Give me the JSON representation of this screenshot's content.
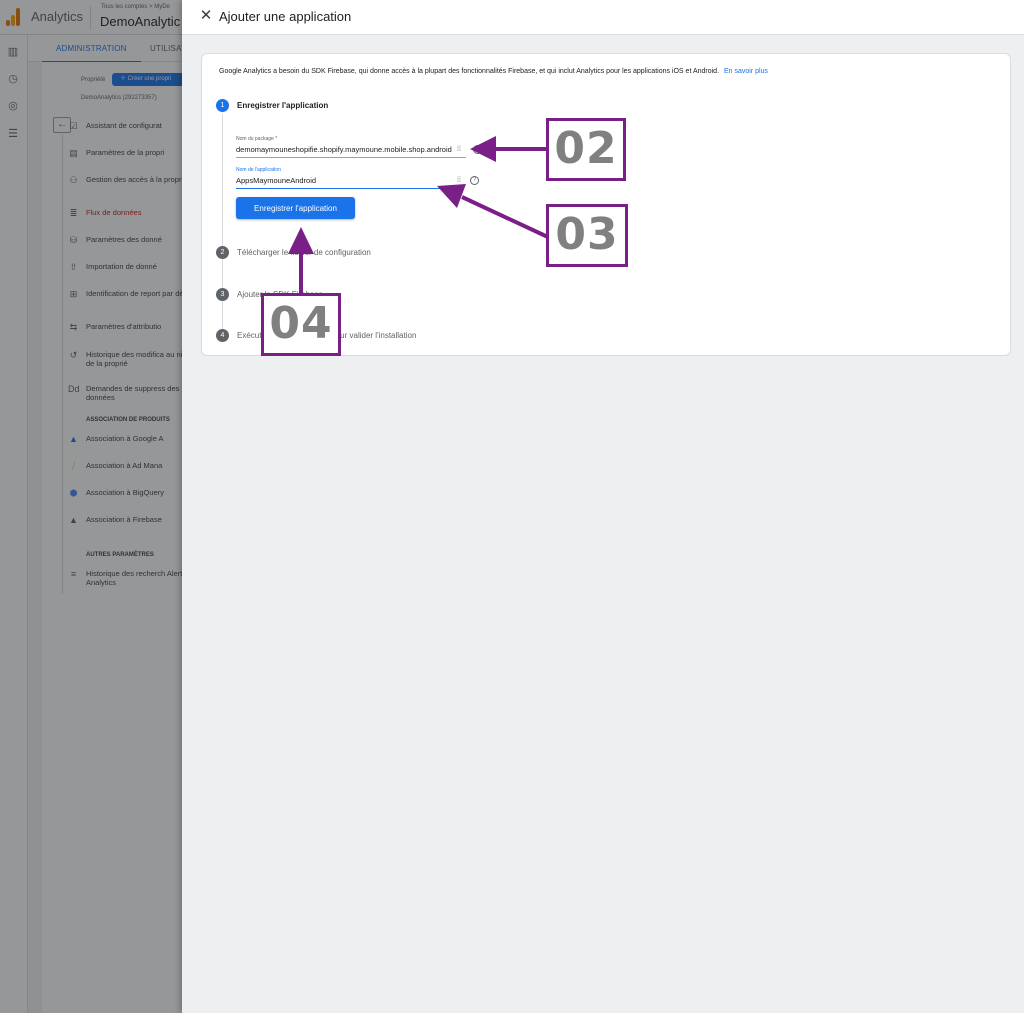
{
  "background": {
    "app_name": "Analytics",
    "breadcrumb": "Tous les comptes > MyDe",
    "property_name": "DemoAnalytic",
    "tabs": [
      "ADMINISTRATION",
      "UTILISAT"
    ],
    "property_label": "Propriété",
    "create_property": "Créer une propri",
    "property_id": "DemoAnalytics (292273357)",
    "nav_items": [
      {
        "label": "Assistant de configurat",
        "icon": "checklist-icon"
      },
      {
        "label": "Paramètres de la propri",
        "icon": "property-settings-icon"
      },
      {
        "label": "Gestion des accès à la propriété",
        "icon": "people-icon"
      },
      {
        "label": "Flux de données",
        "icon": "data-streams-icon",
        "selected": true
      },
      {
        "label": "Paramètres des donné",
        "icon": "database-icon"
      },
      {
        "label": "Importation de donné",
        "icon": "upload-icon"
      },
      {
        "label": "Identification de report par défaut",
        "icon": "reporting-identity-icon"
      },
      {
        "label": "Paramètres d'attributio",
        "icon": "attribution-icon"
      },
      {
        "label": "Historique des modifica au niveau de la proprié",
        "icon": "history-icon"
      },
      {
        "label": "Demandes de suppress des données",
        "icon": "data-deletion-icon"
      }
    ],
    "section_products": "ASSOCIATION DE PRODUITS",
    "product_items": [
      {
        "label": "Association à Google A",
        "icon": "google-ads-icon"
      },
      {
        "label": "Association à Ad Mana",
        "icon": "ad-manager-icon"
      },
      {
        "label": "Association à BigQuery",
        "icon": "bigquery-icon"
      },
      {
        "label": "Association à Firebase",
        "icon": "firebase-icon"
      }
    ],
    "section_other": "AUTRES PARAMÈTRES",
    "other_items": [
      {
        "label": "Historique des recherch Alertes Analytics",
        "icon": "search-history-icon"
      }
    ]
  },
  "dialog": {
    "title": "Ajouter une application",
    "intro": "Google Analytics a besoin du SDK Firebase, qui donne accès à la plupart des fonctionnalités Firebase, et qui inclut Analytics pour les applications iOS et Android.",
    "learn_more": "En savoir plus",
    "steps": [
      {
        "number": "1",
        "label": "Enregistrer l'application",
        "active": true
      },
      {
        "number": "2",
        "label": "Télécharger le fichier de configuration"
      },
      {
        "number": "3",
        "label": "Ajouter le SDK Firebase"
      },
      {
        "number": "4",
        "label": "Exécuter votre application pour valider l'installation"
      }
    ],
    "package_field": {
      "label": "Nom du package *",
      "value": "demomaymouneshopifie.shopify.maymoune.mobile.shop.android"
    },
    "app_name_field": {
      "label": "Nom de l'application",
      "value": "AppsMaymouneAndroid"
    },
    "register_button": "Enregistrer l'application"
  },
  "annotations": {
    "callout_02": "02",
    "callout_03": "03",
    "callout_04": "04",
    "color": "#7a1f88"
  }
}
